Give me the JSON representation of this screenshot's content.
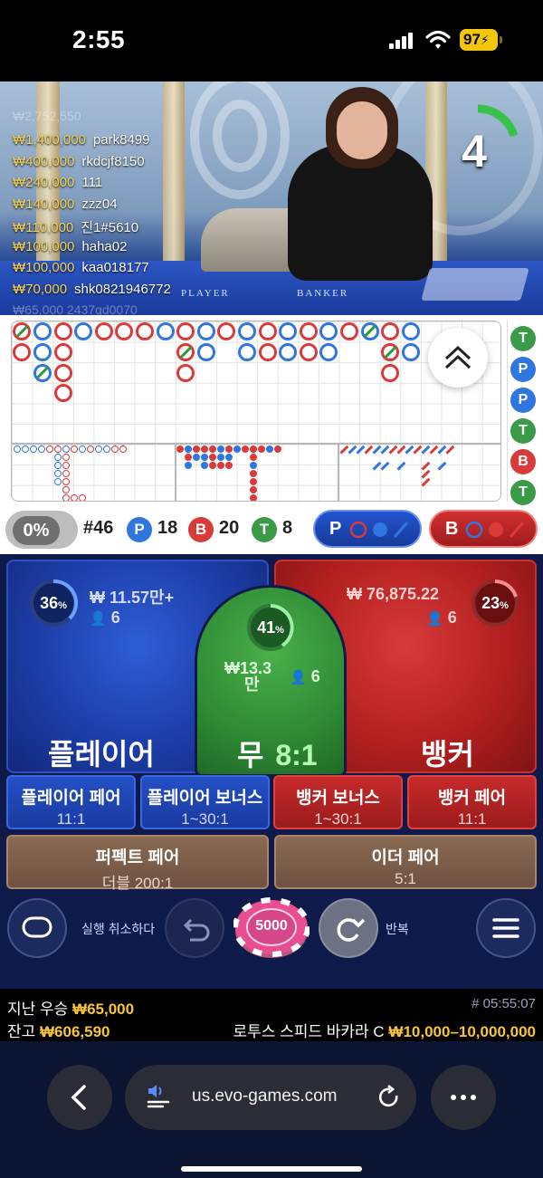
{
  "status": {
    "time": "2:55",
    "battery": "97"
  },
  "video": {
    "winners": [
      {
        "amount": "₩1,400,000",
        "name": "park8499"
      },
      {
        "amount": "₩400,000",
        "name": "rkdcjf8150"
      },
      {
        "amount": "₩240,000",
        "name": "111"
      },
      {
        "amount": "₩140,000",
        "name": "zzz04"
      },
      {
        "amount": "₩110,000",
        "name": "진1#5610"
      },
      {
        "amount": "₩100,000",
        "name": "haha02"
      },
      {
        "amount": "₩100,000",
        "name": "kaa018177"
      },
      {
        "amount": "₩70,000",
        "name": "shk0821946772"
      }
    ],
    "top_ghost": "₩2,752,550",
    "bottom_ghost": "₩65,000 2437gd0070",
    "countdown": "4",
    "felt_player": "PLAYER",
    "felt_banker": "BANKER"
  },
  "roadmap": {
    "predictions": [
      "T",
      "P",
      "P",
      "T",
      "B",
      "T"
    ]
  },
  "stats": {
    "percent_toggle": "0%",
    "round": "#46",
    "player_letter": "P",
    "player_count": "18",
    "banker_letter": "B",
    "banker_count": "20",
    "tie_letter": "T",
    "tie_count": "8",
    "player_ask": "P",
    "banker_ask": "B"
  },
  "bets": {
    "player": {
      "percent": "36",
      "percent_sign": "%",
      "amount": "₩ 11.57만+",
      "players": "6",
      "label": "플레이어"
    },
    "banker": {
      "percent": "23",
      "percent_sign": "%",
      "amount": "₩ 76,875.22",
      "players": "6",
      "label": "뱅커"
    },
    "tie": {
      "percent": "41",
      "percent_sign": "%",
      "amount_line1": "₩13.3",
      "amount_line2": "만",
      "players": "6",
      "label": "무",
      "odds": "8:1"
    },
    "player_pair": {
      "label": "플레이어 페어",
      "odds": "11:1"
    },
    "player_bonus": {
      "label": "플레이어 보너스",
      "odds": "1~30:1"
    },
    "banker_bonus": {
      "label": "뱅커 보너스",
      "odds": "1~30:1"
    },
    "banker_pair": {
      "label": "뱅커 페어",
      "odds": "11:1"
    },
    "perfect_pair": {
      "label": "퍼펙트 페어",
      "odds": "더블 200:1"
    },
    "either_pair": {
      "label": "이더 페어",
      "odds": "5:1"
    }
  },
  "controls": {
    "undo_label": "실행 취소하다",
    "chip_value": "5000",
    "repeat_label": "반복"
  },
  "footer": {
    "last_win_label": "지난 우승",
    "last_win_value": "₩65,000",
    "balance_label": "잔고",
    "balance_value": "₩606,590",
    "game_id": "# 05:55:07",
    "table_name": "로투스 스피드 바카라 C",
    "limits": "₩10,000–10,000,000"
  },
  "browser": {
    "url": "us.evo-games.com"
  },
  "colors": {
    "player": "#2f76e0",
    "banker": "#d93a3a",
    "tie": "#3a9a48",
    "gold": "#f6c53a"
  }
}
